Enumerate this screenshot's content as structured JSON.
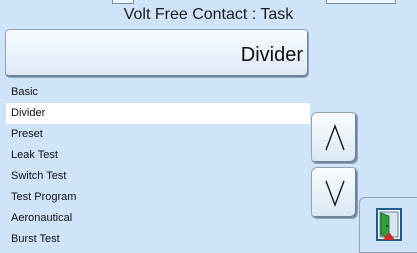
{
  "header": {
    "title": "Volt Free Contact : Task"
  },
  "display": {
    "current_task": "Divider"
  },
  "task_list": {
    "items": [
      {
        "label": "Basic",
        "selected": false
      },
      {
        "label": "Divider",
        "selected": true
      },
      {
        "label": "Preset",
        "selected": false
      },
      {
        "label": "Leak Test",
        "selected": false
      },
      {
        "label": "Switch Test",
        "selected": false
      },
      {
        "label": "Test Program",
        "selected": false
      },
      {
        "label": "Aeronautical",
        "selected": false
      },
      {
        "label": "Burst Test",
        "selected": false
      }
    ]
  },
  "controls": {
    "scroll_up_icon": "chevron-up-icon",
    "scroll_down_icon": "chevron-down-icon",
    "exit_icon": "exit-door-icon"
  },
  "colors": {
    "background": "#cfe4f8",
    "selected_row": "#ffffff",
    "door_frame": "#1f5c8e",
    "door_green": "#2aa13a",
    "door_red": "#d22a2a"
  }
}
